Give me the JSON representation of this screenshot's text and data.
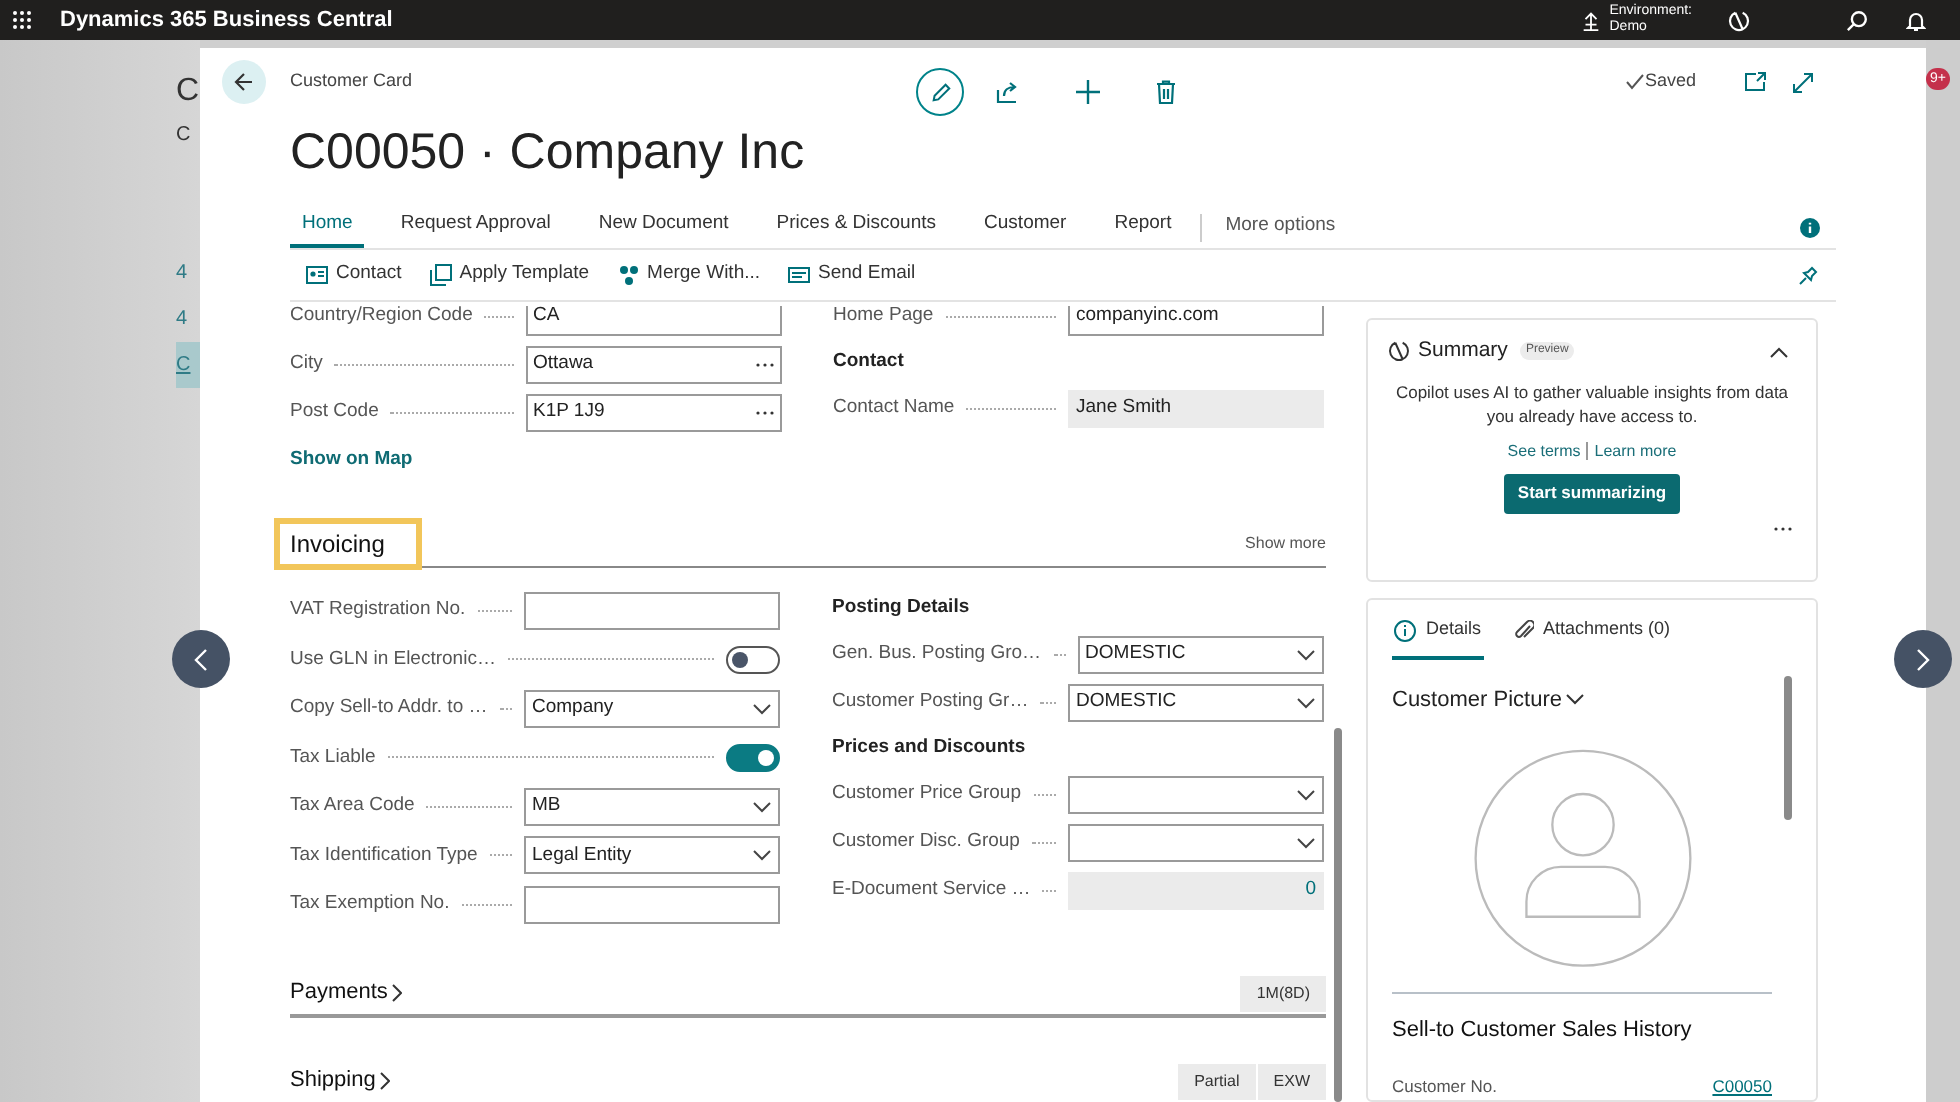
{
  "app": {
    "title": "Dynamics 365 Business Central",
    "environment_label": "Environment:",
    "environment_value": "Demo"
  },
  "background_page": {
    "title": "C",
    "subtitle": "C",
    "rows": [
      {
        "text": "4",
        "selected": false
      },
      {
        "text": "4",
        "selected": false
      },
      {
        "text": "C",
        "selected": true
      }
    ],
    "badge": "9+"
  },
  "card": {
    "breadcrumb": "Customer Card",
    "title": "C00050 · Company Inc",
    "status": "Saved",
    "tabs": [
      {
        "label": "Home",
        "selected": true
      },
      {
        "label": "Request Approval",
        "selected": false
      },
      {
        "label": "New Document",
        "selected": false
      },
      {
        "label": "Prices & Discounts",
        "selected": false
      },
      {
        "label": "Customer",
        "selected": false
      },
      {
        "label": "Report",
        "selected": false
      }
    ],
    "more_options": "More options",
    "actions": [
      {
        "label": "Contact",
        "kind": "contact"
      },
      {
        "label": "Apply Template",
        "kind": "template"
      },
      {
        "label": "Merge With...",
        "kind": "merge"
      },
      {
        "label": "Send Email",
        "kind": "email"
      }
    ],
    "general": {
      "left": [
        {
          "kind": "text",
          "label": "Country/Region Code",
          "value": "CA"
        },
        {
          "kind": "lookup",
          "label": "City",
          "value": "Ottawa"
        },
        {
          "kind": "lookup",
          "label": "Post Code",
          "value": "K1P 1J9"
        }
      ],
      "right": [
        {
          "kind": "text",
          "label": "Home Page",
          "value": "companyinc.com"
        },
        {
          "kind": "heading",
          "label": "Contact"
        },
        {
          "kind": "readonly",
          "label": "Contact Name",
          "value": "Jane Smith"
        }
      ],
      "link": "Show on Map"
    },
    "invoicing": {
      "title": "Invoicing",
      "highlighted": true,
      "show_more": "Show more",
      "left": [
        {
          "kind": "text",
          "label": "VAT Registration No."
        },
        {
          "kind": "toggle",
          "label": "Use GLN in Electronic…",
          "on": false
        },
        {
          "kind": "dropdown",
          "label": "Copy Sell-to Addr. to …",
          "value": "Company"
        },
        {
          "kind": "toggle",
          "label": "Tax Liable",
          "on": true
        },
        {
          "kind": "dropdown",
          "label": "Tax Area Code",
          "value": "MB"
        },
        {
          "kind": "dropdown",
          "label": "Tax Identification Type",
          "value": "Legal Entity"
        },
        {
          "kind": "text",
          "label": "Tax Exemption No."
        }
      ],
      "right": [
        {
          "kind": "heading",
          "label": "Posting Details"
        },
        {
          "kind": "dropdown",
          "label": "Gen. Bus. Posting Gro…",
          "value": "DOMESTIC"
        },
        {
          "kind": "dropdown",
          "label": "Customer Posting Gr…",
          "value": "DOMESTIC"
        },
        {
          "kind": "heading",
          "label": "Prices and Discounts"
        },
        {
          "kind": "dropdown",
          "label": "Customer Price Group"
        },
        {
          "kind": "dropdown",
          "label": "Customer Disc. Group"
        },
        {
          "kind": "count",
          "label": "E-Document Service …",
          "value": "0"
        }
      ]
    },
    "sections": [
      {
        "title": "Payments",
        "badges": [
          "1M(8D)"
        ]
      },
      {
        "title": "Shipping",
        "badges": [
          "Partial",
          "EXW"
        ]
      }
    ]
  },
  "factbox": {
    "summary": {
      "title": "Summary",
      "badge": "Preview",
      "description": "Copilot uses AI to gather valuable insights from data you already have access to.",
      "links": [
        "See terms",
        "Learn more"
      ],
      "button": "Start summarizing"
    },
    "tabs": [
      {
        "label": "Details",
        "kind": "details",
        "selected": true
      },
      {
        "label": "Attachments (0)",
        "kind": "attachments",
        "selected": false
      }
    ],
    "picture_title": "Customer Picture",
    "history_title": "Sell-to Customer Sales History",
    "history_rows": [
      {
        "label": "Customer No.",
        "value": "C00050"
      }
    ]
  }
}
